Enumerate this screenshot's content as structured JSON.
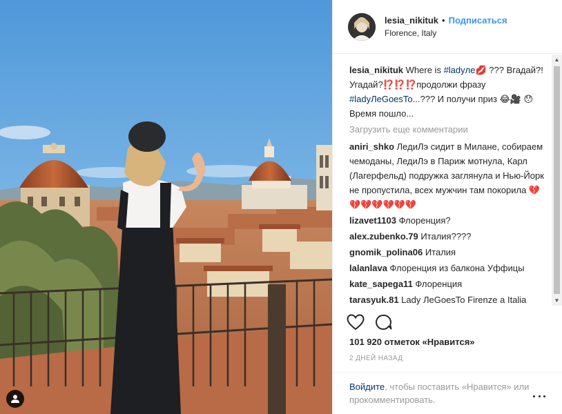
{
  "post": {
    "username": "lesia_nikituk",
    "separator": "•",
    "follow_label": "Подписаться",
    "location": "Florence, Italy",
    "caption": {
      "username": "lesia_nikituk",
      "part1": " Where is ",
      "tag1": "#ladyле💋",
      "part2": " ??? Вгадай?!Угадай?⁉️⁉️⁉️продолжи фразу ",
      "tag2": "#ladyЛеGoesTo",
      "part3": "...??? И получи приз 😂🎥 😯Время пошло..."
    },
    "load_more_label": "Загрузить еще комментарии",
    "comments": [
      {
        "user": "aniri_shko",
        "text": " ЛедиЛэ сидит в Милане, собираем чемоданы, ЛедиЛэ в Париж мотнула, Карл (Лагерфельд) подружка заглянула и Нью-Йорк не пропустила, всех мужчин там покорила 💔💔💔💔💔💔💔"
      },
      {
        "user": "lizavet1103",
        "text": " Флоренция?"
      },
      {
        "user": "alex.zubenko.79",
        "text": " Италия????"
      },
      {
        "user": "gnomik_polina06",
        "text": " Италия"
      },
      {
        "user": "lalanlava",
        "text": " Флоренция из балкона Уффицы"
      },
      {
        "user": "kate_sapega11",
        "text": " Флоренция"
      },
      {
        "user": "tarasyuk.81",
        "text": " Lady ЛеGoesTo Firenze a Italia"
      }
    ],
    "likes_text": "101 920 отметок «Нравится»",
    "timestamp": "2 ДНЕЙ НАЗАД",
    "footer": {
      "login_link": "Войдите",
      "rest": ", чтобы поставить «Нравится» или прокомментировать."
    }
  },
  "icons": {
    "like": "heart-icon",
    "comment": "comment-bubble-icon",
    "more": "more-options-icon",
    "tagged": "tagged-user-icon"
  },
  "colors": {
    "link_blue": "#3897f0",
    "hashtag": "#003569",
    "muted": "#999999",
    "text": "#262626"
  }
}
